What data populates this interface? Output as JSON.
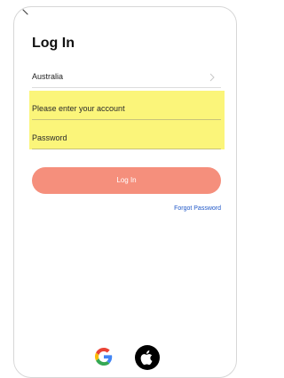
{
  "header": {
    "title": "Log In"
  },
  "region": {
    "value": "Australia"
  },
  "form": {
    "account_placeholder": "Please enter your account",
    "password_placeholder": "Password",
    "login_label": "Log In",
    "forgot_label": "Forgot Password"
  },
  "social": {
    "google_icon": "google-icon",
    "apple_icon": "apple-icon"
  },
  "colors": {
    "accent": "#f58f7c",
    "link": "#1f57c7",
    "highlight": "#fbf57a"
  }
}
